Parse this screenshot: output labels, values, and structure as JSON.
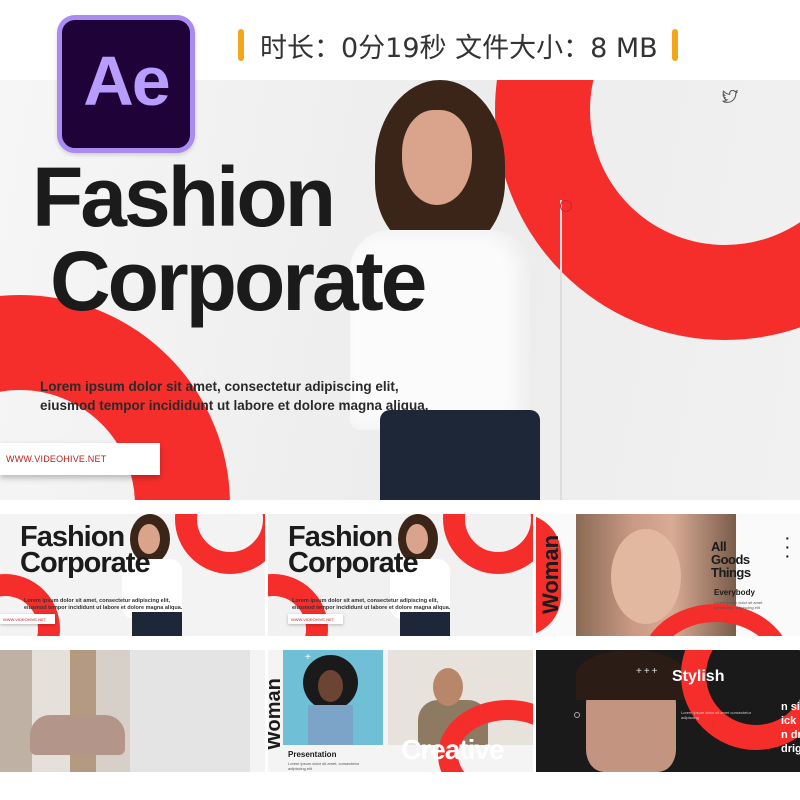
{
  "header": {
    "app_logo_text": "Ae",
    "info_text": "时长：0分19秒  文件大小：8 MB"
  },
  "hero": {
    "title_line1": "Fashion",
    "title_line2": "Corporate",
    "body_line1": "Lorem ipsum dolor sit amet, consectetur adipiscing elit,",
    "body_line2": "eiusmod tempor incididunt ut labore et dolore magna aliqua.",
    "url": "WWW.VIDEOHIVE.NET",
    "social_icon": "twitter-icon"
  },
  "thumbnails": {
    "t1": {
      "title_line1": "Fashion",
      "title_line2": "Corporate",
      "body": "Lorem ipsum dolor sit amet, consectetur adipiscing elit, eiusmod tempor incididunt ut labore et dolore magna aliqua.",
      "url": "WWW.VIDEOHIVE.NET"
    },
    "t2": {
      "title_line1": "Fashion",
      "title_line2": "Corporate",
      "body": "Lorem ipsum dolor sit amet, consectetur adipiscing elit, eiusmod tempor incididunt ut labore et dolore magna aliqua.",
      "url": "WWW.VIDEOHIVE.NET"
    },
    "t3": {
      "vertical_word": "Woman",
      "goods_line1": "All",
      "goods_line2": "Goods",
      "goods_line3": "Things",
      "everybody": "Everybody",
      "copy": "Lorem ipsum dolor sit amet consectetur adipiscing elit"
    },
    "t5": {
      "vertical_word": "Woman",
      "presentation": "Presentation",
      "copy": "Lorem ipsum dolor sit amet, consectetur adipiscing elit",
      "creative": "Creative"
    },
    "t6": {
      "stylish": "Stylish",
      "plus": "+++",
      "side_line1": "n si",
      "side_line2": "ick",
      "side_line3": "n dr",
      "side_line4": "drig",
      "copy": "Lorem ipsum dolor sit amet consectetur adipiscing"
    }
  },
  "colors": {
    "accent_red": "#f62e2b",
    "ae_bg": "#1f0338",
    "ae_border": "#a98cf2",
    "info_accent": "#f3a51c"
  }
}
